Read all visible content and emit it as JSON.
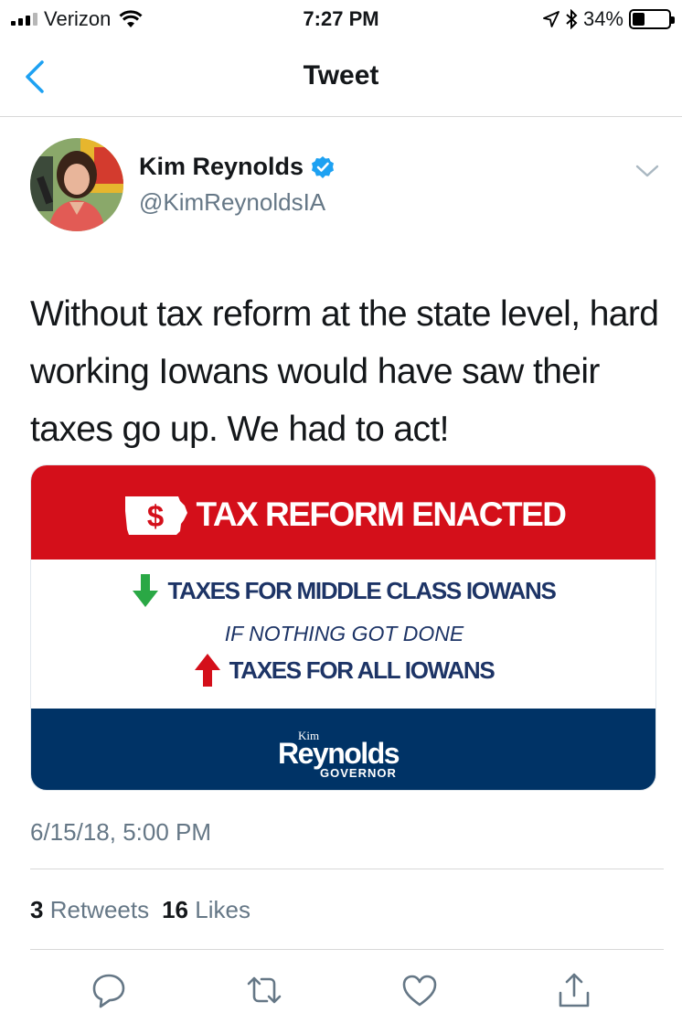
{
  "status_bar": {
    "carrier": "Verizon",
    "time": "7:27 PM",
    "battery": "34%",
    "battery_level": 0.34
  },
  "nav": {
    "title": "Tweet"
  },
  "tweet": {
    "author_name": "Kim Reynolds",
    "author_handle": "@KimReynoldsIA",
    "text": "Without tax reform at the state level, hard working Iowans would have saw their taxes go up. We had to act!",
    "timestamp": "6/15/18, 5:00 PM",
    "retweets_count": "3",
    "retweets_label": "Retweets",
    "likes_count": "16",
    "likes_label": "Likes"
  },
  "card": {
    "dollar": "$",
    "title": "TAX REFORM ENACTED",
    "line1": "TAXES FOR MIDDLE CLASS IOWANS",
    "line2": "IF NOTHING GOT DONE",
    "line3": "TAXES FOR ALL IOWANS",
    "logo_small": "Kim",
    "logo_main": "Reynolds",
    "logo_sub": "GOVERNOR"
  },
  "colors": {
    "link_blue": "#1da1f2",
    "card_red": "#d40f1a",
    "card_navy": "#003366",
    "text_gray": "#657786"
  },
  "icons": [
    "back-chevron-icon",
    "verified-badge-icon",
    "caret-down-icon",
    "reply-icon",
    "retweet-icon",
    "like-icon",
    "share-icon"
  ]
}
